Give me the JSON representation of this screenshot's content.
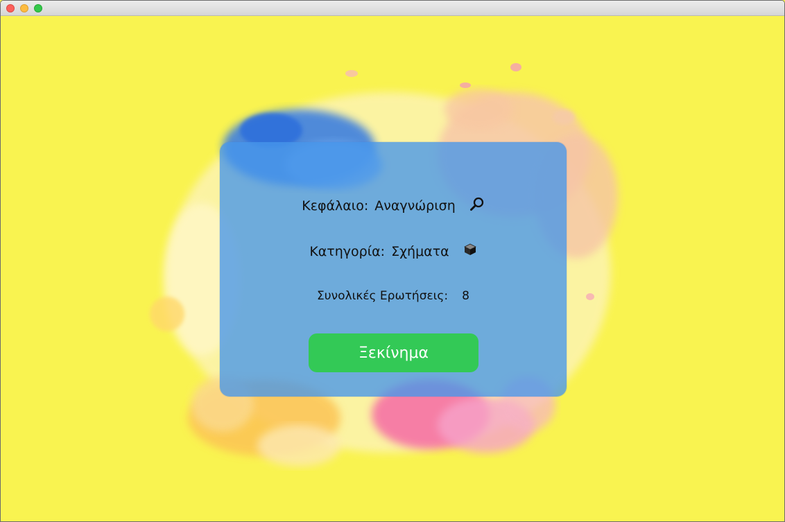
{
  "window": {
    "controls": [
      "close",
      "minimize",
      "zoom"
    ]
  },
  "quiz": {
    "chapter_label": "Κεφάλαιο:",
    "chapter_value": "Αναγνώριση",
    "chapter_icon": "magnifier-icon",
    "category_label": "Κατηγορία:",
    "category_value": "Σχήματα",
    "category_icon": "cube-icon",
    "total_label": "Συνολικές Ερωτήσεις:",
    "total_value": "8",
    "start_label": "Ξεκίνημα"
  },
  "colors": {
    "background": "#f9f350",
    "card": "#4696eb",
    "start_button": "#33c956"
  }
}
